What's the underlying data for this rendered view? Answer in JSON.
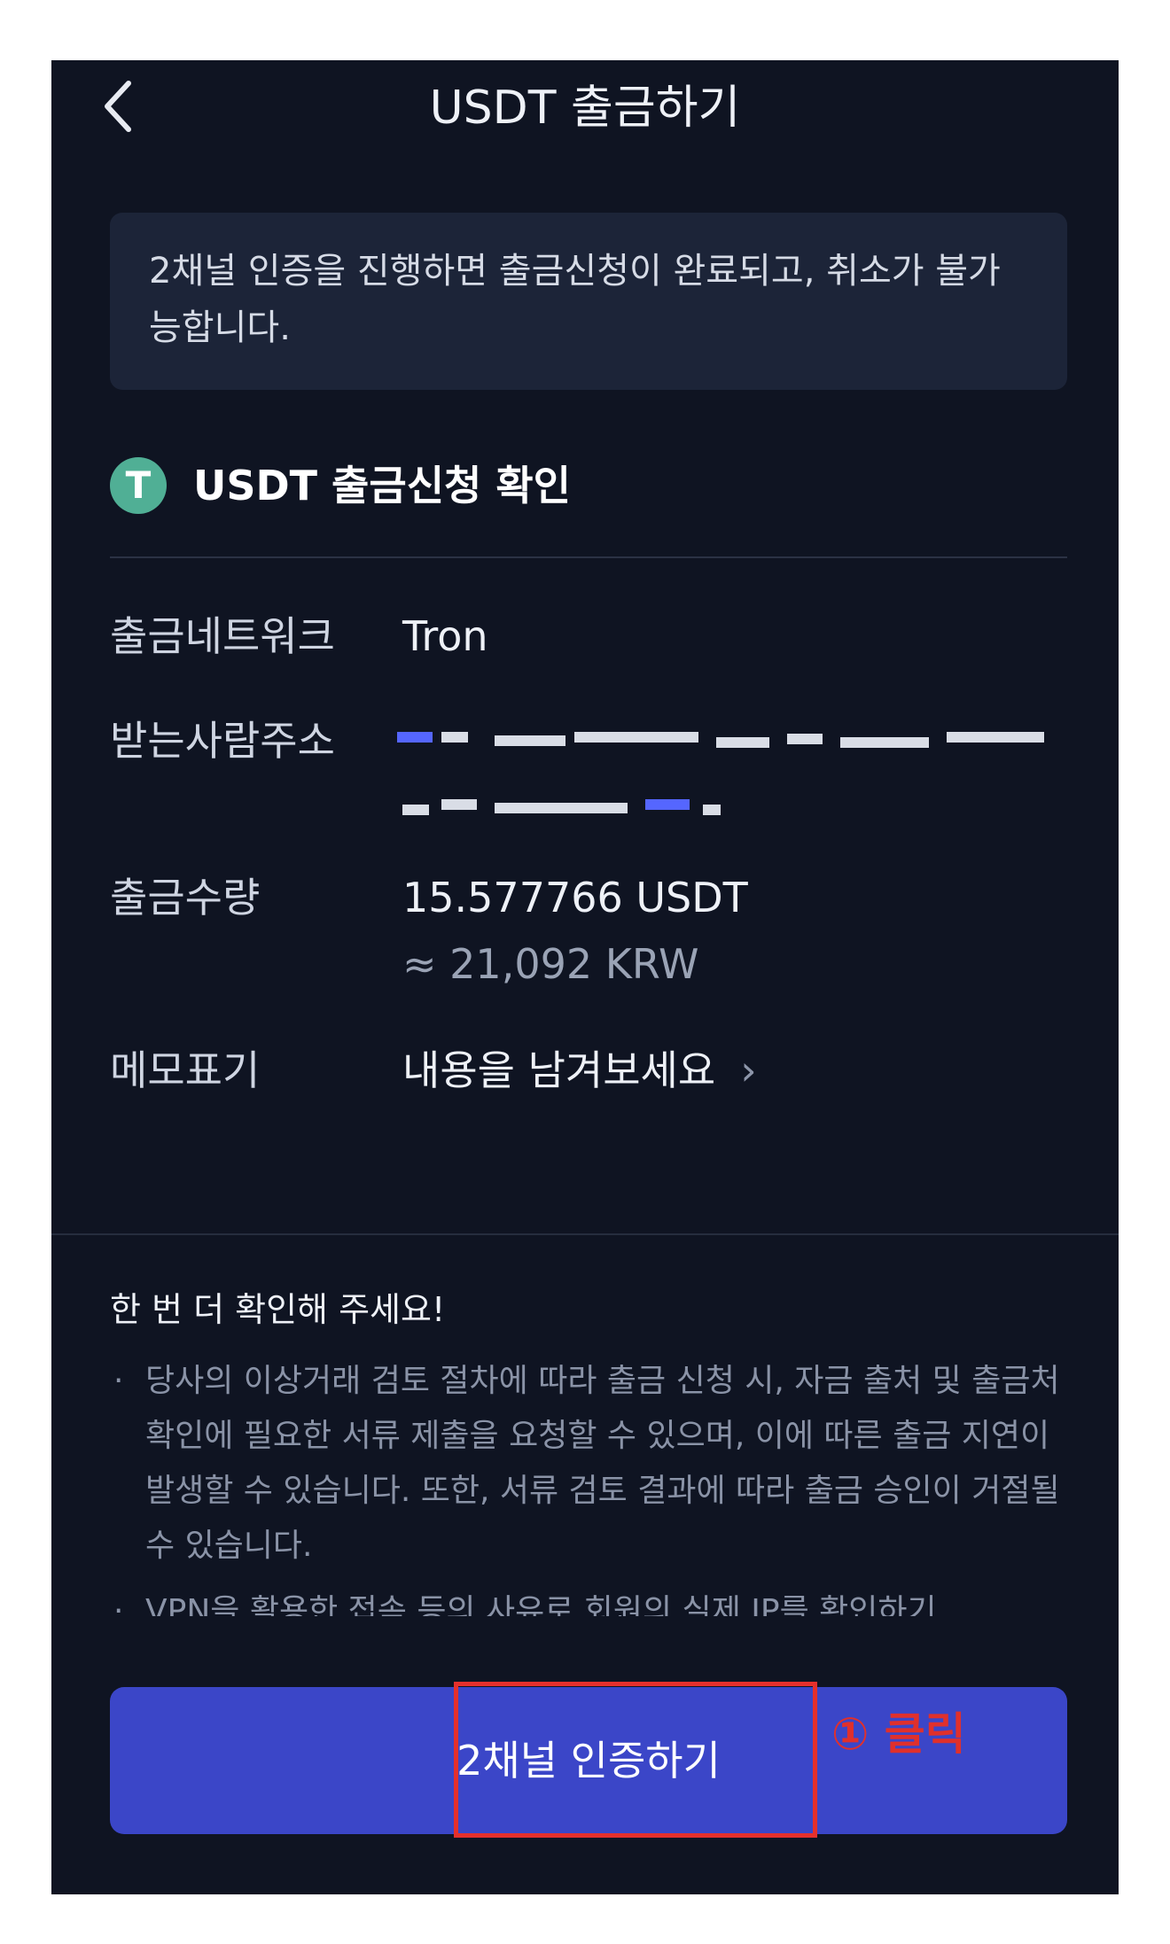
{
  "header": {
    "title": "USDT 출금하기"
  },
  "notice": {
    "text": "2채널 인증을 진행하면 출금신청이 완료되고, 취소가 불가능합니다."
  },
  "confirm": {
    "icon_glyph": "T",
    "title": "USDT 출금신청 확인"
  },
  "details": {
    "network_label": "출금네트워크",
    "network_value": "Tron",
    "address_label": "받는사람주소",
    "amount_label": "출금수량",
    "amount_value": "15.577766 USDT",
    "amount_krw": "≈ 21,092 KRW",
    "memo_label": "메모표기",
    "memo_value": "내용을 남겨보세요",
    "memo_chevron": "›"
  },
  "warning": {
    "title": "한 번 더 확인해 주세요!",
    "items": [
      "당사의 이상거래 검토 절차에 따라 출금 신청 시, 자금 출처 및 출금처 확인에 필요한 서류 제출을 요청할 수 있으며, 이에 따른 출금 지연이 발생할 수 있습니다. 또한, 서류 검토 결과에 따라 출금 승인이 거절될 수 있습니다.",
      "VPN을 활용한 접속 등의 사유로 회원의 실제 IP를 확인하기"
    ]
  },
  "action": {
    "button_label": "2채널 인증하기"
  },
  "annotation": {
    "text": "① 클릭",
    "color": "#e0302c"
  },
  "colors": {
    "background": "#0f1422",
    "button": "#3b46c8",
    "tether": "#50af95"
  }
}
